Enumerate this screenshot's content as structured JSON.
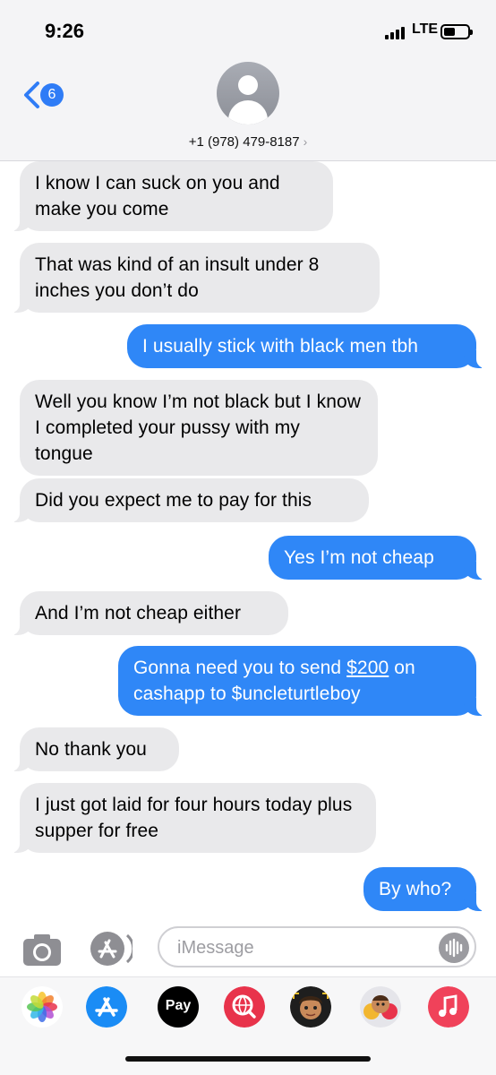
{
  "status": {
    "time": "9:26",
    "network": "LTE"
  },
  "header": {
    "back_count": "6",
    "contact": "+1 (978) 479-8187",
    "chevron": "›"
  },
  "messages": [
    {
      "type": "received",
      "text": "I know I can suck on you and make you come"
    },
    {
      "type": "received",
      "text": "That was kind of an insult under 8 inches you don’t do"
    },
    {
      "type": "sent",
      "text": "I usually stick with black men tbh"
    },
    {
      "type": "received",
      "text": "Well you know I’m not black but I know I completed your pussy with my tongue"
    },
    {
      "type": "received",
      "text": "Did you expect me to pay for this"
    },
    {
      "type": "sent",
      "text": "Yes I’m not cheap"
    },
    {
      "type": "received",
      "text": "And I’m not cheap either"
    },
    {
      "type": "sent",
      "text_before": "Gonna need you to send ",
      "link": "$200",
      "text_after": " on cashapp to $uncleturtleboy"
    },
    {
      "type": "received",
      "text": "No thank you"
    },
    {
      "type": "received",
      "text": "I just got laid for four hours today plus supper for free"
    },
    {
      "type": "sent",
      "text": "By who?"
    }
  ],
  "input": {
    "placeholder": "iMessage"
  },
  "apps": [
    {
      "name": "photos-app-icon",
      "color": "#ffffff"
    },
    {
      "name": "app-store-icon",
      "color": "#1a8cf5"
    },
    {
      "name": "apple-pay-icon",
      "color": "#000000",
      "label": "Pay"
    },
    {
      "name": "web-search-icon",
      "color": "#e8334b"
    },
    {
      "name": "memoji-icon",
      "color": "#222222"
    },
    {
      "name": "memoji-stickers-icon",
      "color": "#dddddd"
    },
    {
      "name": "music-icon",
      "color": "#f0425a"
    }
  ]
}
